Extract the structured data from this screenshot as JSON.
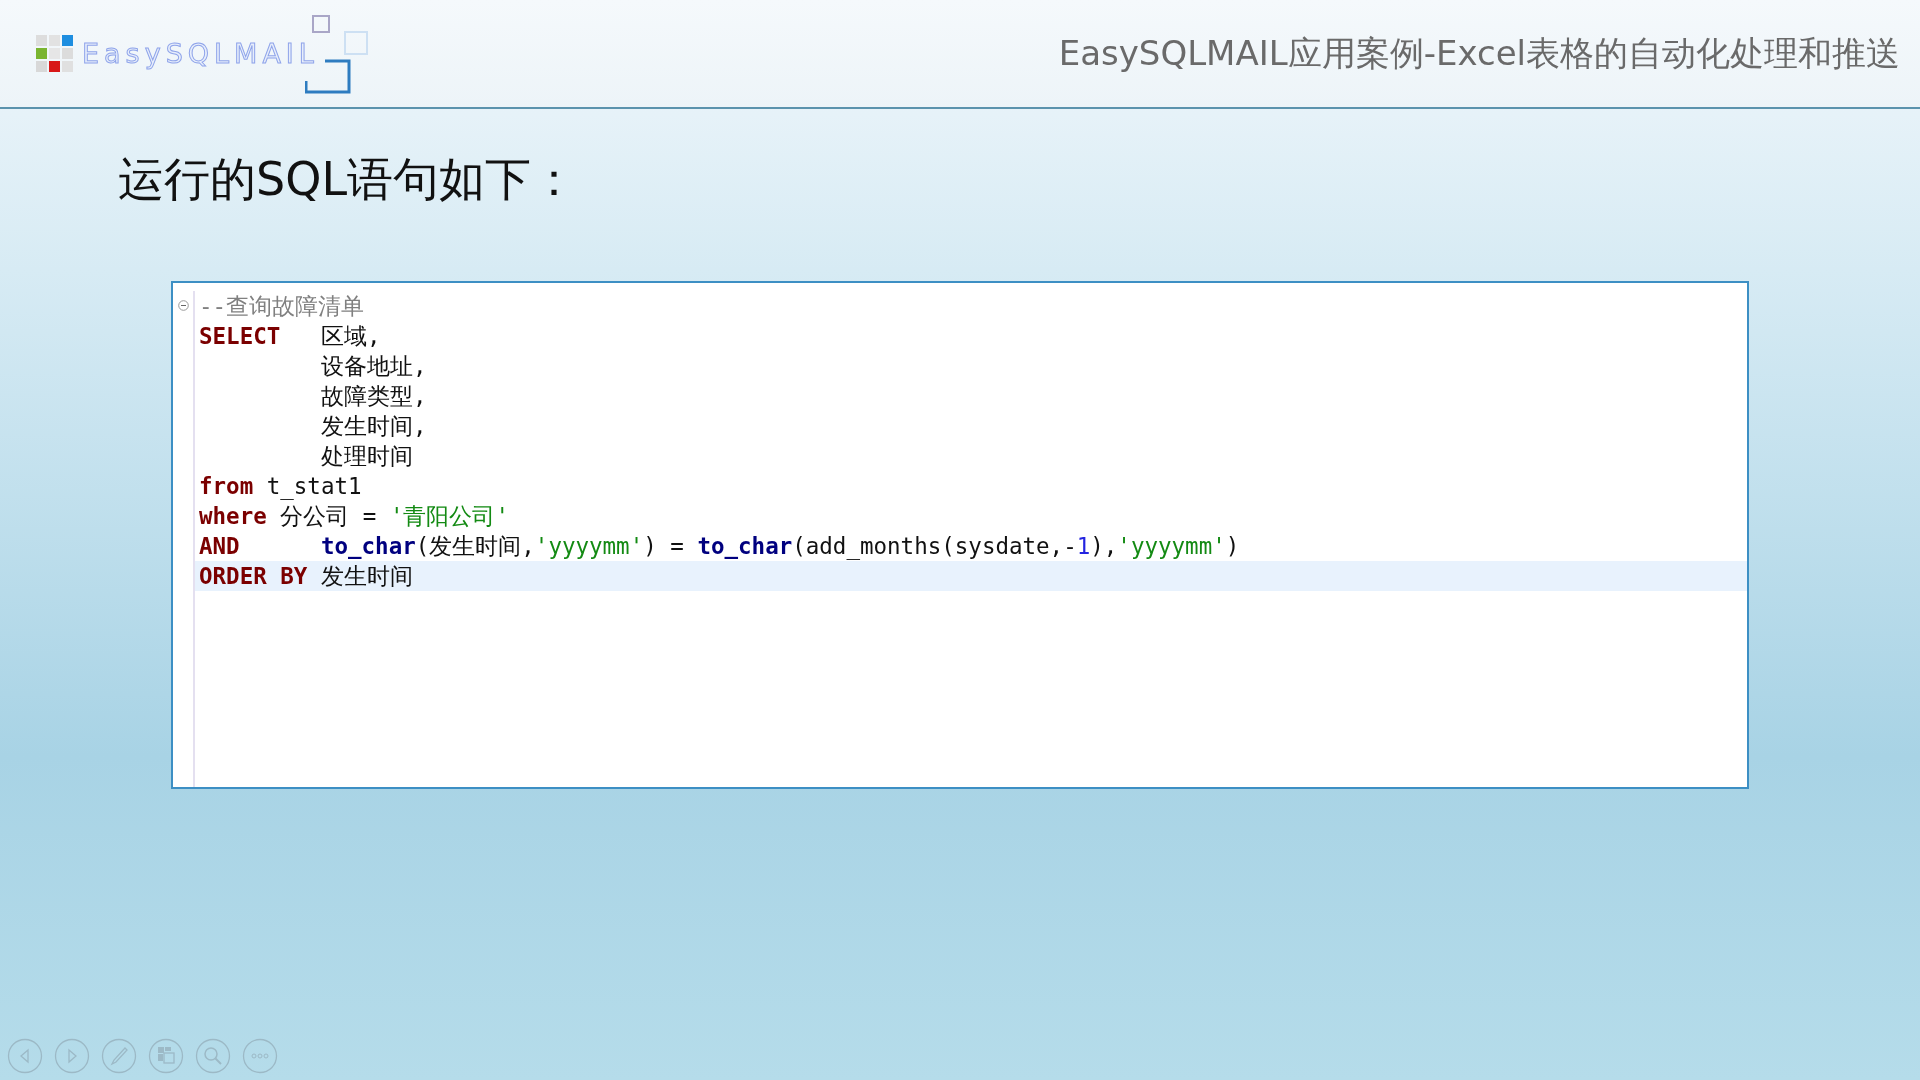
{
  "header": {
    "logo_text": "EasySQLMAIL",
    "title": "EasySQLMAIL应用案例-Excel表格的自动化处理和推送"
  },
  "heading": "运行的SQL语句如下：",
  "editor": {
    "lines": [
      {
        "fold": true,
        "highlighted": false,
        "tokens": [
          {
            "kind": "comment",
            "text": "--查询故障清单"
          }
        ]
      },
      {
        "highlighted": false,
        "tokens": [
          {
            "kind": "keyword",
            "text": "SELECT"
          },
          {
            "kind": "plain",
            "text": "   区域,"
          }
        ]
      },
      {
        "highlighted": false,
        "tokens": [
          {
            "kind": "plain",
            "text": "         设备地址,"
          }
        ]
      },
      {
        "highlighted": false,
        "tokens": [
          {
            "kind": "plain",
            "text": "         故障类型,"
          }
        ]
      },
      {
        "highlighted": false,
        "tokens": [
          {
            "kind": "plain",
            "text": "         发生时间,"
          }
        ]
      },
      {
        "highlighted": false,
        "tokens": [
          {
            "kind": "plain",
            "text": "         处理时间"
          }
        ]
      },
      {
        "highlighted": false,
        "tokens": [
          {
            "kind": "keyword",
            "text": "from"
          },
          {
            "kind": "plain",
            "text": " t_stat1"
          }
        ]
      },
      {
        "highlighted": false,
        "tokens": [
          {
            "kind": "keyword",
            "text": "where"
          },
          {
            "kind": "plain",
            "text": " 分公司 = "
          },
          {
            "kind": "string",
            "text": "'青阳公司'"
          }
        ]
      },
      {
        "highlighted": false,
        "tokens": [
          {
            "kind": "keyword",
            "text": "AND"
          },
          {
            "kind": "func",
            "text": "      to_char"
          },
          {
            "kind": "plain",
            "text": "(发生时间,"
          },
          {
            "kind": "string",
            "text": "'yyyymm'"
          },
          {
            "kind": "plain",
            "text": ") = "
          },
          {
            "kind": "func",
            "text": "to_char"
          },
          {
            "kind": "plain",
            "text": "(add_months(sysdate,-"
          },
          {
            "kind": "number",
            "text": "1"
          },
          {
            "kind": "plain",
            "text": "),"
          },
          {
            "kind": "string",
            "text": "'yyyymm'"
          },
          {
            "kind": "plain",
            "text": ")"
          }
        ]
      },
      {
        "highlighted": true,
        "tokens": [
          {
            "kind": "keyword",
            "text": "ORDER BY"
          },
          {
            "kind": "plain",
            "text": " 发生时间"
          }
        ]
      }
    ]
  },
  "controls": [
    {
      "kind": "previous"
    },
    {
      "kind": "next"
    },
    {
      "kind": "pen"
    },
    {
      "kind": "slides"
    },
    {
      "kind": "zoom"
    },
    {
      "kind": "more"
    }
  ]
}
